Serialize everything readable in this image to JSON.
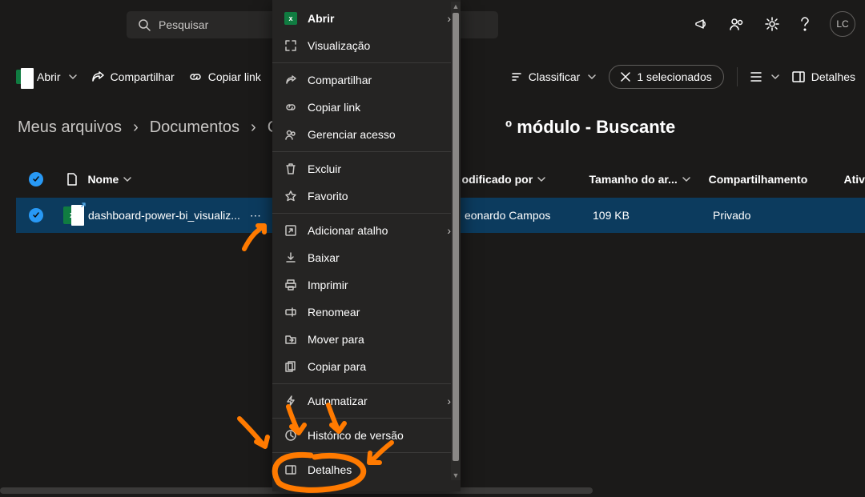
{
  "search": {
    "placeholder": "Pesquisar"
  },
  "avatar": {
    "initials": "LC"
  },
  "commands": {
    "open": "Abrir",
    "share": "Compartilhar",
    "copy_link": "Copiar link",
    "sort": "Classificar",
    "selected": "1 selecionados",
    "details": "Detalhes"
  },
  "breadcrumb": {
    "items": [
      "Meus arquivos",
      "Documentos",
      "Curso"
    ],
    "tail": "º módulo - Buscante"
  },
  "columns": {
    "name": "Nome",
    "modified": "",
    "modified_by": "odificado por",
    "size": "Tamanho do ar...",
    "sharing": "Compartilhamento",
    "activity": "Ativ"
  },
  "row": {
    "filename": "dashboard-power-bi_visualiz...",
    "modified_by": "eonardo Campos",
    "size": "109 KB",
    "sharing": "Privado"
  },
  "menu": {
    "open": "Abrir",
    "preview": "Visualização",
    "share": "Compartilhar",
    "copylink": "Copiar link",
    "manage": "Gerenciar acesso",
    "delete": "Excluir",
    "favorite": "Favorito",
    "shortcut": "Adicionar atalho",
    "download": "Baixar",
    "print": "Imprimir",
    "rename": "Renomear",
    "moveto": "Mover para",
    "copyto": "Copiar para",
    "automate": "Automatizar",
    "history": "Histórico de versão",
    "details": "Detalhes"
  }
}
